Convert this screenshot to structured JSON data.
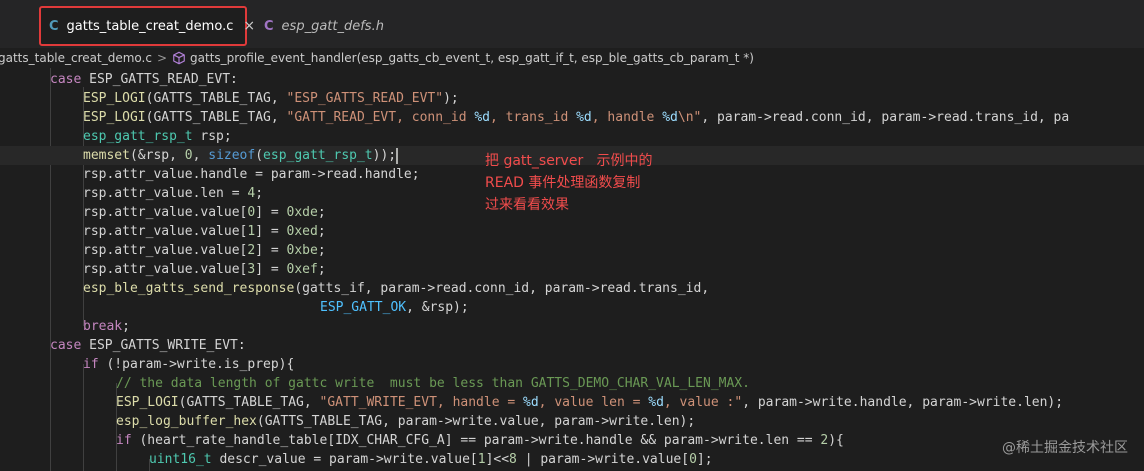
{
  "tabs": [
    {
      "icon": "C",
      "label": "gatts_table_creat_demo.c",
      "close": "×",
      "active": true
    },
    {
      "icon": "C",
      "label": "esp_gatt_defs.h",
      "active": false
    }
  ],
  "breadcrumb": {
    "file": "gatts_table_creat_demo.c",
    "separator": ">",
    "symbol": "gatts_profile_event_handler(esp_gatts_cb_event_t, esp_gatt_if_t, esp_ble_gatts_cb_param_t *)"
  },
  "code": {
    "l1": [
      "case",
      " ESP_GATTS_READ_EVT:"
    ],
    "l2": [
      "ESP_LOGI",
      "(GATTS_TABLE_TAG, ",
      "\"ESP_GATTS_READ_EVT\"",
      ");"
    ],
    "l3": [
      "ESP_LOGI",
      "(GATTS_TABLE_TAG, ",
      "\"GATT_READ_EVT, conn_id ",
      "%d",
      ", trans_id ",
      "%d",
      ", handle ",
      "%d",
      "\\n\"",
      ", param->read.conn_id, param->read.trans_id, pa"
    ],
    "l4": [
      "esp_gatt_rsp_t",
      " rsp;"
    ],
    "l5": [
      "memset",
      "(&rsp, ",
      "0",
      ", ",
      "sizeof",
      "(",
      "esp_gatt_rsp_t",
      "));"
    ],
    "l6": "rsp.attr_value.handle = param->read.handle;",
    "l7": [
      "rsp.attr_value.len = ",
      "4",
      ";"
    ],
    "l8": [
      "rsp.attr_value.value[",
      "0",
      "] = ",
      "0xde",
      ";"
    ],
    "l9": [
      "rsp.attr_value.value[",
      "1",
      "] = ",
      "0xed",
      ";"
    ],
    "l10": [
      "rsp.attr_value.value[",
      "2",
      "] = ",
      "0xbe",
      ";"
    ],
    "l11": [
      "rsp.attr_value.value[",
      "3",
      "] = ",
      "0xef",
      ";"
    ],
    "l12": [
      "esp_ble_gatts_send_response",
      "(gatts_if, param->read.conn_id, param->read.trans_id,"
    ],
    "l13": [
      "ESP_GATT_OK",
      ", &rsp);"
    ],
    "l14": [
      "break",
      ";"
    ],
    "l15": [
      "case",
      " ESP_GATTS_WRITE_EVT:"
    ],
    "l16": [
      "if",
      " (!param->write.is_prep){"
    ],
    "l17": "// the data length of gattc write  must be less than GATTS_DEMO_CHAR_VAL_LEN_MAX.",
    "l18": [
      "ESP_LOGI",
      "(GATTS_TABLE_TAG, ",
      "\"GATT_WRITE_EVT, handle = ",
      "%d",
      ", value len = ",
      "%d",
      ", value :\"",
      ", param->write.handle, param->write.len);"
    ],
    "l19": [
      "esp_log_buffer_hex",
      "(GATTS_TABLE_TAG, param->write.value, param->write.len);"
    ],
    "l20": [
      "if",
      " (heart_rate_handle_table[IDX_CHAR_CFG_A] == param->write.handle && param->write.len == ",
      "2",
      "){"
    ],
    "l21": [
      "uint16_t",
      " descr_value = param->write.value[",
      "1",
      "]<<",
      "8",
      " | param->write.value[",
      "0",
      "];"
    ]
  },
  "annotation": [
    "把 gatt_server   示例中的",
    "READ 事件处理函数复制",
    "过来看看效果"
  ],
  "watermark": "@稀土掘金技术社区",
  "colors": {
    "highlight_border": "#e03a3a",
    "annotation_text": "#f14c4c"
  }
}
